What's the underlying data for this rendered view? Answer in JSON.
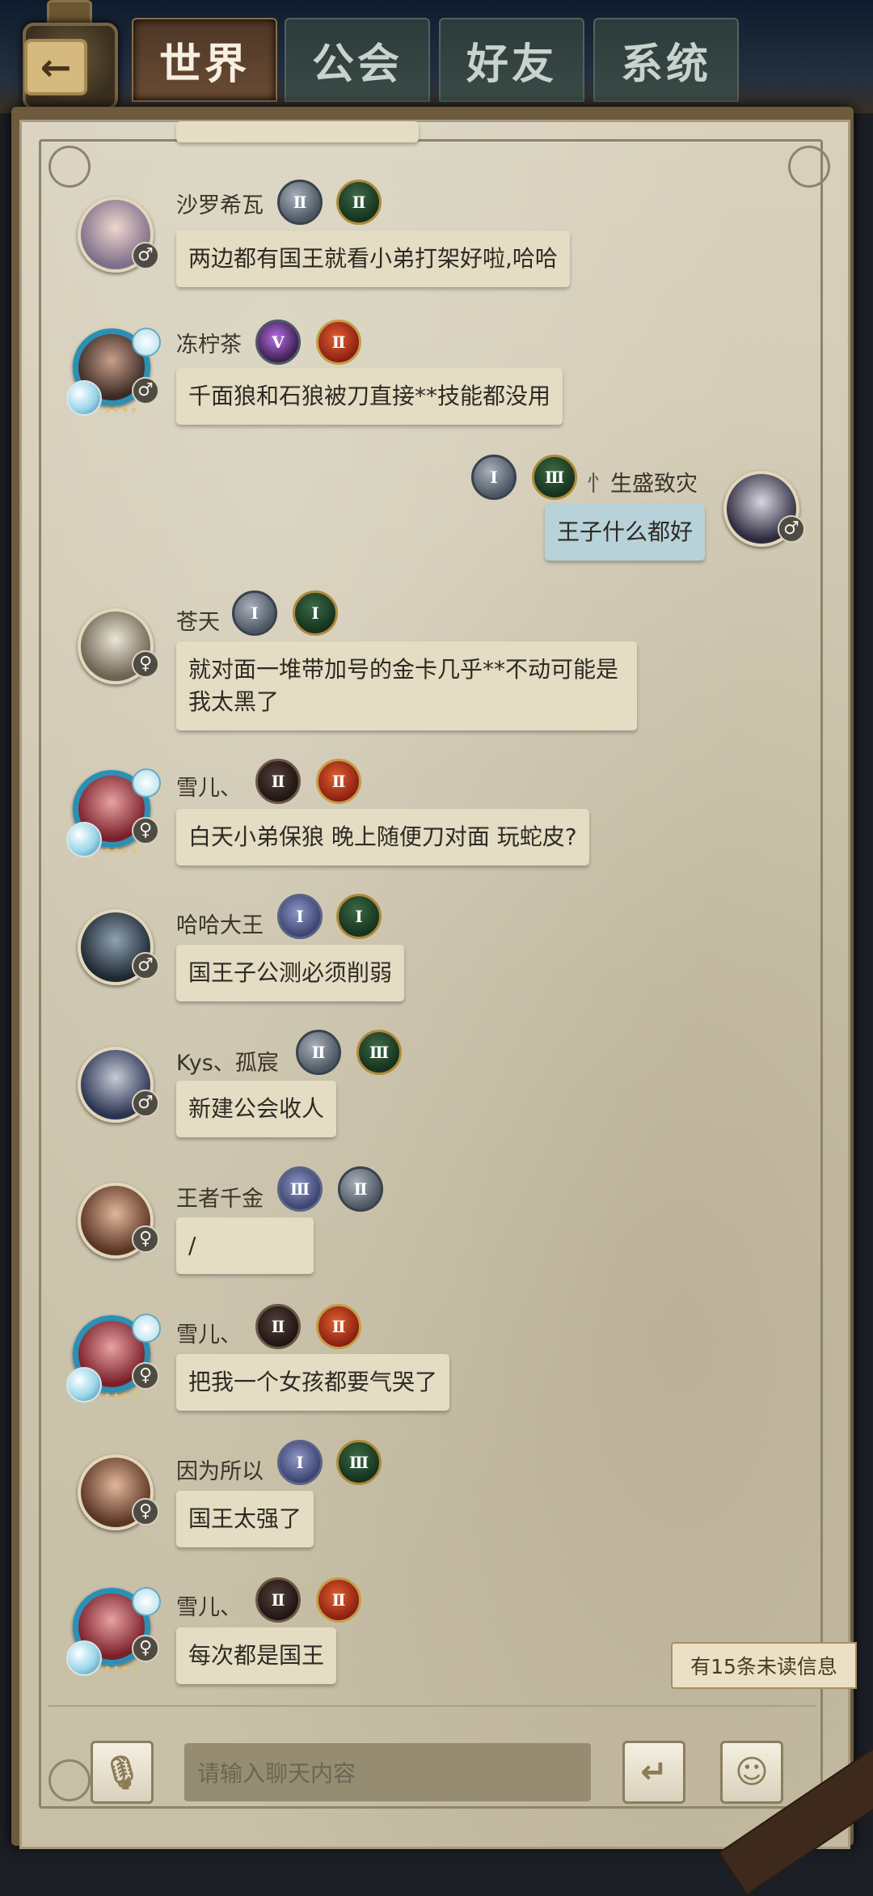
{
  "tabs": [
    {
      "label": "世界",
      "active": true
    },
    {
      "label": "公会",
      "active": false
    },
    {
      "label": "好友",
      "active": false
    },
    {
      "label": "系统",
      "active": false
    }
  ],
  "back_icon": "back-arrow-icon",
  "messages": [
    {
      "name": "沙罗希瓦",
      "text": "两边都有国王就看小弟打架好啦,哈哈",
      "gender": "♂",
      "badges": [
        "Ⅱ",
        "Ⅱ"
      ]
    },
    {
      "name": "冻柠茶",
      "text": "千面狼和石狼被刀直接**技能都没用",
      "gender": "♂",
      "badges": [
        "Ⅴ",
        "Ⅱ"
      ]
    },
    {
      "name": "生盛致灾",
      "prefix": "忄",
      "text": "王子什么都好",
      "gender": "♂",
      "badges": [
        "Ⅰ",
        "Ⅲ"
      ],
      "self": true
    },
    {
      "name": "苍天",
      "text": "就对面一堆带加号的金卡几乎**不动可能是我太黑了",
      "gender": "♀",
      "badges": [
        "Ⅰ",
        "Ⅰ"
      ]
    },
    {
      "name": "雪儿、",
      "text": "白天小弟保狼 晚上随便刀对面 玩蛇皮?",
      "gender": "♀",
      "badges": [
        "Ⅱ",
        "Ⅱ"
      ]
    },
    {
      "name": "哈哈大王",
      "text": "国王子公测必须削弱",
      "gender": "♂",
      "badges": [
        "Ⅰ",
        "Ⅰ"
      ]
    },
    {
      "name": "Kys、孤宸",
      "text": "新建公会收人",
      "gender": "♂",
      "badges": [
        "Ⅱ",
        "Ⅲ"
      ]
    },
    {
      "name": "王者千金",
      "text": "/",
      "gender": "♀",
      "badges": [
        "Ⅲ",
        "Ⅱ"
      ]
    },
    {
      "name": "雪儿、",
      "text": "把我一个女孩都要气哭了",
      "gender": "♀",
      "badges": [
        "Ⅱ",
        "Ⅱ"
      ]
    },
    {
      "name": "因为所以",
      "text": "国王太强了",
      "gender": "♀",
      "badges": [
        "Ⅰ",
        "Ⅲ"
      ]
    },
    {
      "name": "雪儿、",
      "text": "每次都是国王",
      "gender": "♀",
      "badges": [
        "Ⅱ",
        "Ⅱ"
      ]
    }
  ],
  "unread_notice": "有15条未读信息",
  "input": {
    "placeholder": "请输入聊天内容"
  },
  "buttons": {
    "voice_icon": "microphone-icon",
    "send_icon": "enter-icon",
    "emoji_icon": "emoji-icon"
  }
}
